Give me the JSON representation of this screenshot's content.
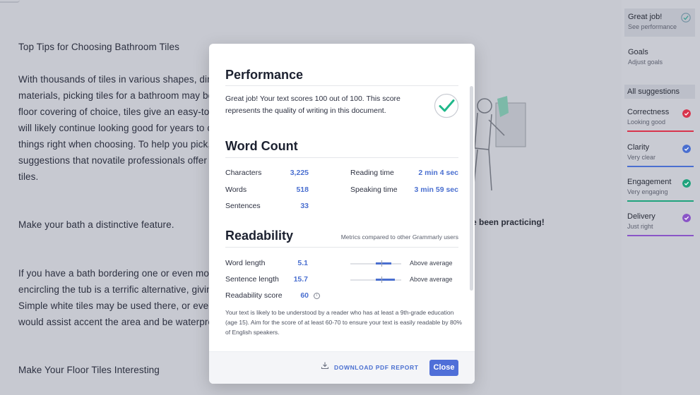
{
  "document": {
    "lines": [
      "Top Tips for Choosing Bathroom Tiles",
      "With thousands of tiles in various shapes, dim",
      "materials, picking tiles for a bathroom may be",
      "floor covering of choice, tiles give an easy-to-",
      "will likely continue looking good for years to c",
      "things right when choosing. To help you pick,",
      "suggestions that novatile professionals offer v",
      "tiles.",
      "Make your bath a distinctive feature.",
      "If you have a bath bordering one or even more",
      "encircling the tub is a terrific alternative, givin",
      "Simple white tiles may be used there, or even",
      "would assist accent the area and be waterpro",
      "Make Your Floor Tiles Interesting"
    ],
    "behind_modal_text": "e been practicing!"
  },
  "sidebar": {
    "top": {
      "title": "Great job!",
      "subtitle": "See performance"
    },
    "goals": {
      "title": "Goals",
      "subtitle": "Adjust goals"
    },
    "all_suggestions": "All suggestions",
    "categories": [
      {
        "title": "Correctness",
        "subtitle": "Looking good",
        "color": "#d8344c"
      },
      {
        "title": "Clarity",
        "subtitle": "Very clear",
        "color": "#4a6fd0"
      },
      {
        "title": "Engagement",
        "subtitle": "Very engaging",
        "color": "#1fa37d"
      },
      {
        "title": "Delivery",
        "subtitle": "Just right",
        "color": "#8a55c7"
      }
    ]
  },
  "modal": {
    "performance": {
      "title": "Performance",
      "text": "Great job! Your text scores 100 out of 100. This score represents the quality of writing in this document."
    },
    "word_count": {
      "title": "Word Count",
      "characters_label": "Characters",
      "characters_value": "3,225",
      "words_label": "Words",
      "words_value": "518",
      "sentences_label": "Sentences",
      "sentences_value": "33",
      "reading_label": "Reading time",
      "reading_value": "2 min 4 sec",
      "speaking_label": "Speaking time",
      "speaking_value": "3 min 59 sec"
    },
    "readability": {
      "title": "Readability",
      "note": "Metrics compared to other Grammarly users",
      "word_length_label": "Word length",
      "word_length_value": "5.1",
      "word_length_status": "Above average",
      "sentence_length_label": "Sentence length",
      "sentence_length_value": "15.7",
      "sentence_length_status": "Above average",
      "score_label": "Readability score",
      "score_value": "60",
      "text": "Your text is likely to be understood by a reader who has at least a 9th-grade education (age 15). Aim for the score of at least 60-70 to ensure your text is easily readable by 80% of English speakers."
    },
    "footer": {
      "download_label": "DOWNLOAD PDF REPORT",
      "close_label": "Close"
    }
  },
  "colors": {
    "accent": "#4a6fd0",
    "success": "#1fb88a"
  }
}
